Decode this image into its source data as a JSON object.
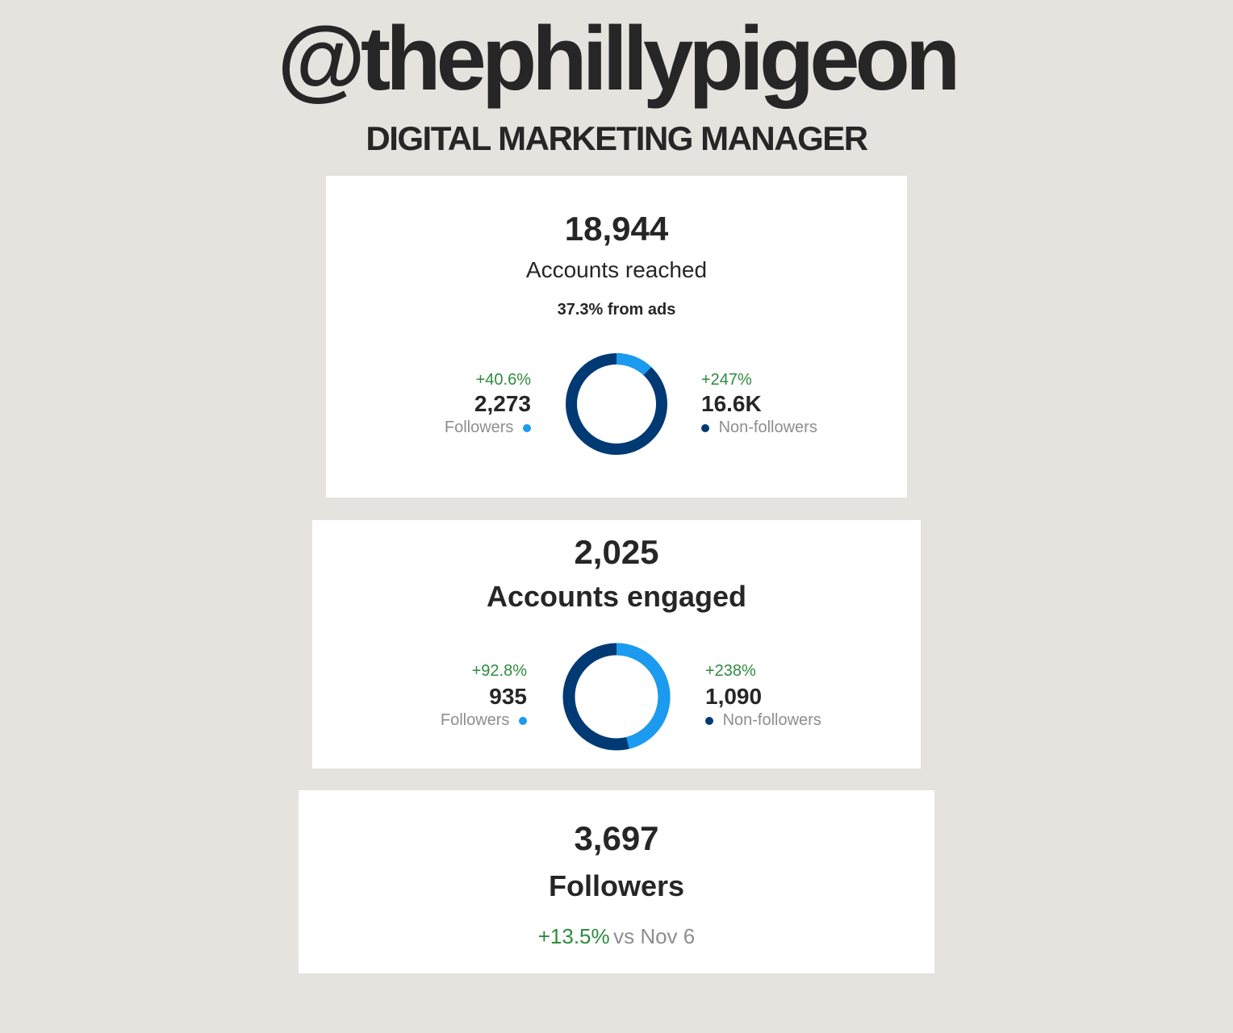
{
  "header": {
    "handle": "@thephillypigeon",
    "role": "DIGITAL MARKETING MANAGER"
  },
  "reach": {
    "total": "18,944",
    "label": "Accounts reached",
    "ads_note": "37.3% from ads",
    "followers": {
      "delta": "+40.6%",
      "value": "2,273",
      "label": "Followers"
    },
    "non_followers": {
      "delta": "+247%",
      "value": "16.6K",
      "label": "Non-followers"
    },
    "followers_fraction": 0.12
  },
  "engaged": {
    "total": "2,025",
    "label": "Accounts engaged",
    "followers": {
      "delta": "+92.8%",
      "value": "935",
      "label": "Followers"
    },
    "non_followers": {
      "delta": "+238%",
      "value": "1,090",
      "label": "Non-followers"
    },
    "followers_fraction": 0.462
  },
  "followers_card": {
    "total": "3,697",
    "label": "Followers",
    "delta": "+13.5%",
    "vs": "vs Nov 6"
  },
  "colors": {
    "followers": "#1a9bf0",
    "non_followers": "#003a75",
    "positive": "#2e8b3e"
  }
}
